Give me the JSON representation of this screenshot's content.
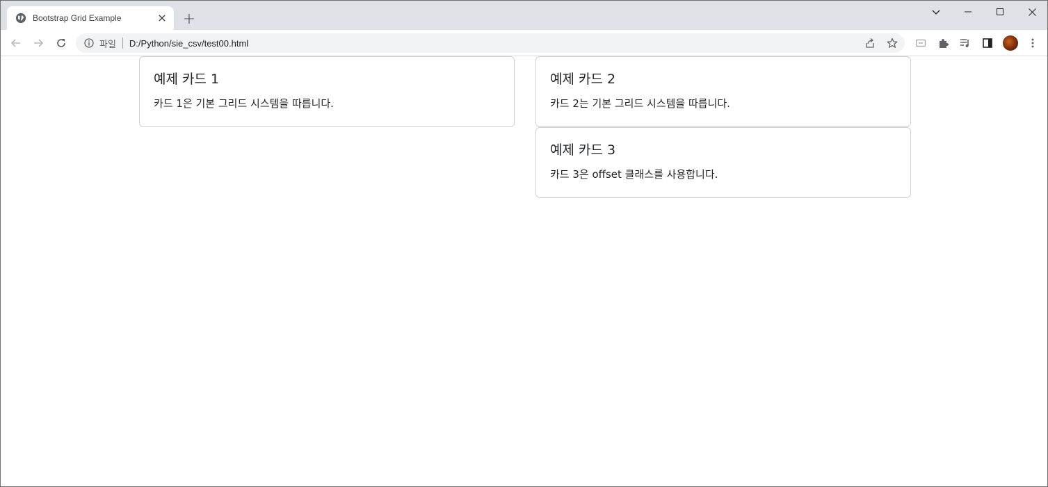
{
  "browser": {
    "tab_title": "Bootstrap Grid Example",
    "new_tab_label": "+",
    "scheme_label": "파일",
    "url": "D:/Python/sie_csv/test00.html"
  },
  "cards": [
    {
      "title": "예제 카드 1",
      "text": "카드 1은 기본 그리드 시스템을 따릅니다."
    },
    {
      "title": "예제 카드 2",
      "text": "카드 2는 기본 그리드 시스템을 따릅니다."
    },
    {
      "title": "예제 카드 3",
      "text": "카드 3은 offset 클래스를 사용합니다."
    }
  ],
  "colors": {
    "tabstrip_bg": "#dee1e6",
    "omnibox_bg": "#f1f3f4",
    "card_border": "#dfdfdf",
    "text": "#212529"
  }
}
